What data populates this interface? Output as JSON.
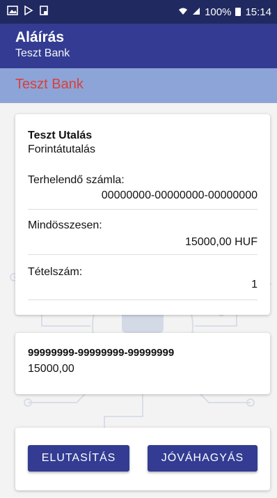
{
  "status_bar": {
    "battery": "100%",
    "time": "15:14"
  },
  "app_bar": {
    "title": "Aláírás",
    "subtitle": "Teszt Bank"
  },
  "bank_bar": {
    "label": "Teszt Bank"
  },
  "transaction": {
    "title": "Teszt Utalás",
    "type": "Forintátutalás",
    "fields": [
      {
        "label": "Terhelendő számla:",
        "value": "00000000-00000000-00000000"
      },
      {
        "label": "Mindösszesen:",
        "value": "15000,00 HUF"
      },
      {
        "label": "Tételszám:",
        "value": "1"
      }
    ]
  },
  "item": {
    "account": "99999999-99999999-99999999",
    "amount": "15000,00"
  },
  "actions": {
    "reject_label": "ELUTASÍTÁS",
    "approve_label": "JÓVÁHAGYÁS"
  },
  "colors": {
    "primary": "#333c92",
    "status_bar": "#202a60",
    "bank_bar": "#8da4d8",
    "bank_text": "#d8403a"
  }
}
